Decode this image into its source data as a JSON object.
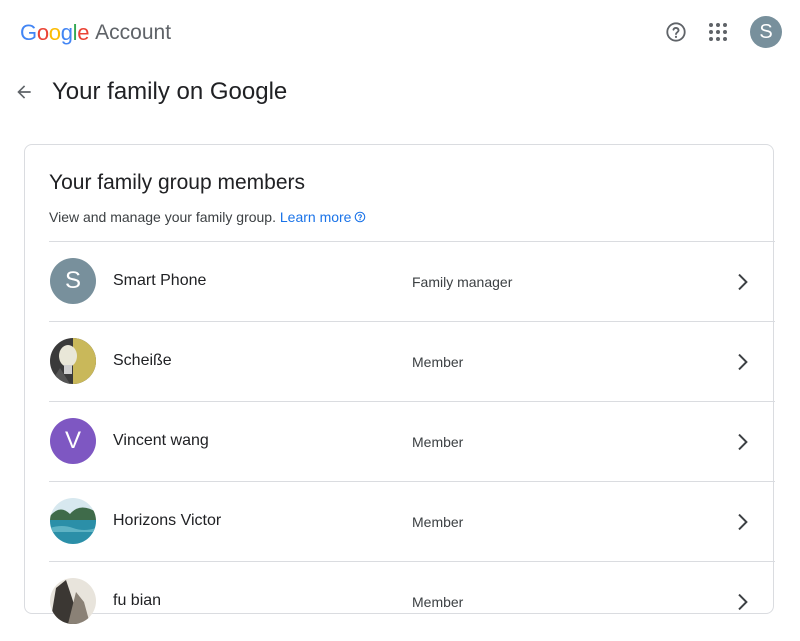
{
  "header": {
    "logo_letters": [
      {
        "char": "G",
        "color": "#4285F4"
      },
      {
        "char": "o",
        "color": "#EA4335"
      },
      {
        "char": "o",
        "color": "#FBBC05"
      },
      {
        "char": "g",
        "color": "#4285F4"
      },
      {
        "char": "l",
        "color": "#34A853"
      },
      {
        "char": "e",
        "color": "#EA4335"
      }
    ],
    "product": "Account",
    "help_icon": "help-circle-icon",
    "apps_icon": "apps-grid-icon",
    "avatar_initial": "S",
    "avatar_color": "#78909c"
  },
  "page": {
    "back_icon": "arrow-back-icon",
    "title": "Your family on Google"
  },
  "card": {
    "title": "Your family group members",
    "subtitle": "View and manage your family group.",
    "learn_more": "Learn more",
    "members": [
      {
        "name": "Smart Phone",
        "role": "Family manager",
        "avatar_type": "initial",
        "initial": "S",
        "color": "#78909c"
      },
      {
        "name": "Scheiße",
        "role": "Member",
        "avatar_type": "photo",
        "photo": "lightbulb-photo"
      },
      {
        "name": "Vincent wang",
        "role": "Member",
        "avatar_type": "initial",
        "initial": "V",
        "color": "#7e57c2"
      },
      {
        "name": "Horizons Victor",
        "role": "Member",
        "avatar_type": "photo",
        "photo": "lake-photo"
      },
      {
        "name": "fu bian",
        "role": "Member",
        "avatar_type": "photo",
        "photo": "rock-photo"
      }
    ]
  }
}
